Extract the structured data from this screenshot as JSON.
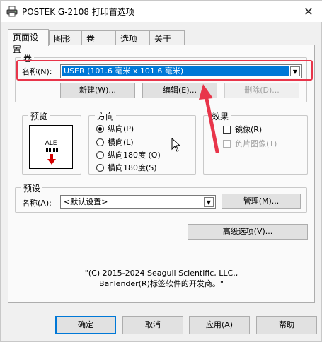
{
  "window": {
    "title": "POSTEK G-2108 打印首选项",
    "close_glyph": "✕"
  },
  "tabs": [
    {
      "label": "页面设置",
      "active": true
    },
    {
      "label": "图形",
      "active": false
    },
    {
      "label": "卷",
      "active": false
    },
    {
      "label": "选项",
      "active": false
    },
    {
      "label": "关于",
      "active": false
    }
  ],
  "roll_group": {
    "legend": "卷",
    "name_label": "名称(N):",
    "name_value": "USER (101.6 毫米 x 101.6 毫米)",
    "new_button": "新建(W)...",
    "edit_button": "编辑(E)...",
    "delete_button": "删除(D)..."
  },
  "preview_group": {
    "legend": "预览",
    "sample_text": "ALE"
  },
  "orientation_group": {
    "legend": "方向",
    "options": [
      {
        "label": "纵向(P)",
        "selected": true
      },
      {
        "label": "横向(L)",
        "selected": false
      },
      {
        "label": "纵向180度 (O)",
        "selected": false
      },
      {
        "label": "横向180度(S)",
        "selected": false
      }
    ]
  },
  "effects_group": {
    "legend": "效果",
    "mirror_label": "镜像(R)",
    "mirror_checked": false,
    "negative_label": "负片图像(T)",
    "negative_checked": false,
    "negative_enabled": false
  },
  "preset_group": {
    "legend": "预设",
    "name_label": "名称(A):",
    "name_value": "<默认设置>",
    "manage_button": "管理(M)..."
  },
  "advanced_button": "高级选项(V)...",
  "copyright": {
    "line1": "\"(C) 2015-2024 Seagull Scientific, LLC.,",
    "line2": "BarTender(R)标签软件的开发商。\""
  },
  "buttons": {
    "ok": "确定",
    "cancel": "取消",
    "apply": "应用(A)",
    "help": "帮助"
  },
  "colors": {
    "highlight_box": "#e8354a",
    "selection": "#0078d7",
    "arrow": "#e8354a",
    "preview_arrow": "#d40000"
  },
  "icons": {
    "app_icon": "printer-icon",
    "combo_arrow": "chevron-down-icon",
    "annotation_arrow": "arrow-icon",
    "cursor": "mouse-cursor-icon"
  }
}
